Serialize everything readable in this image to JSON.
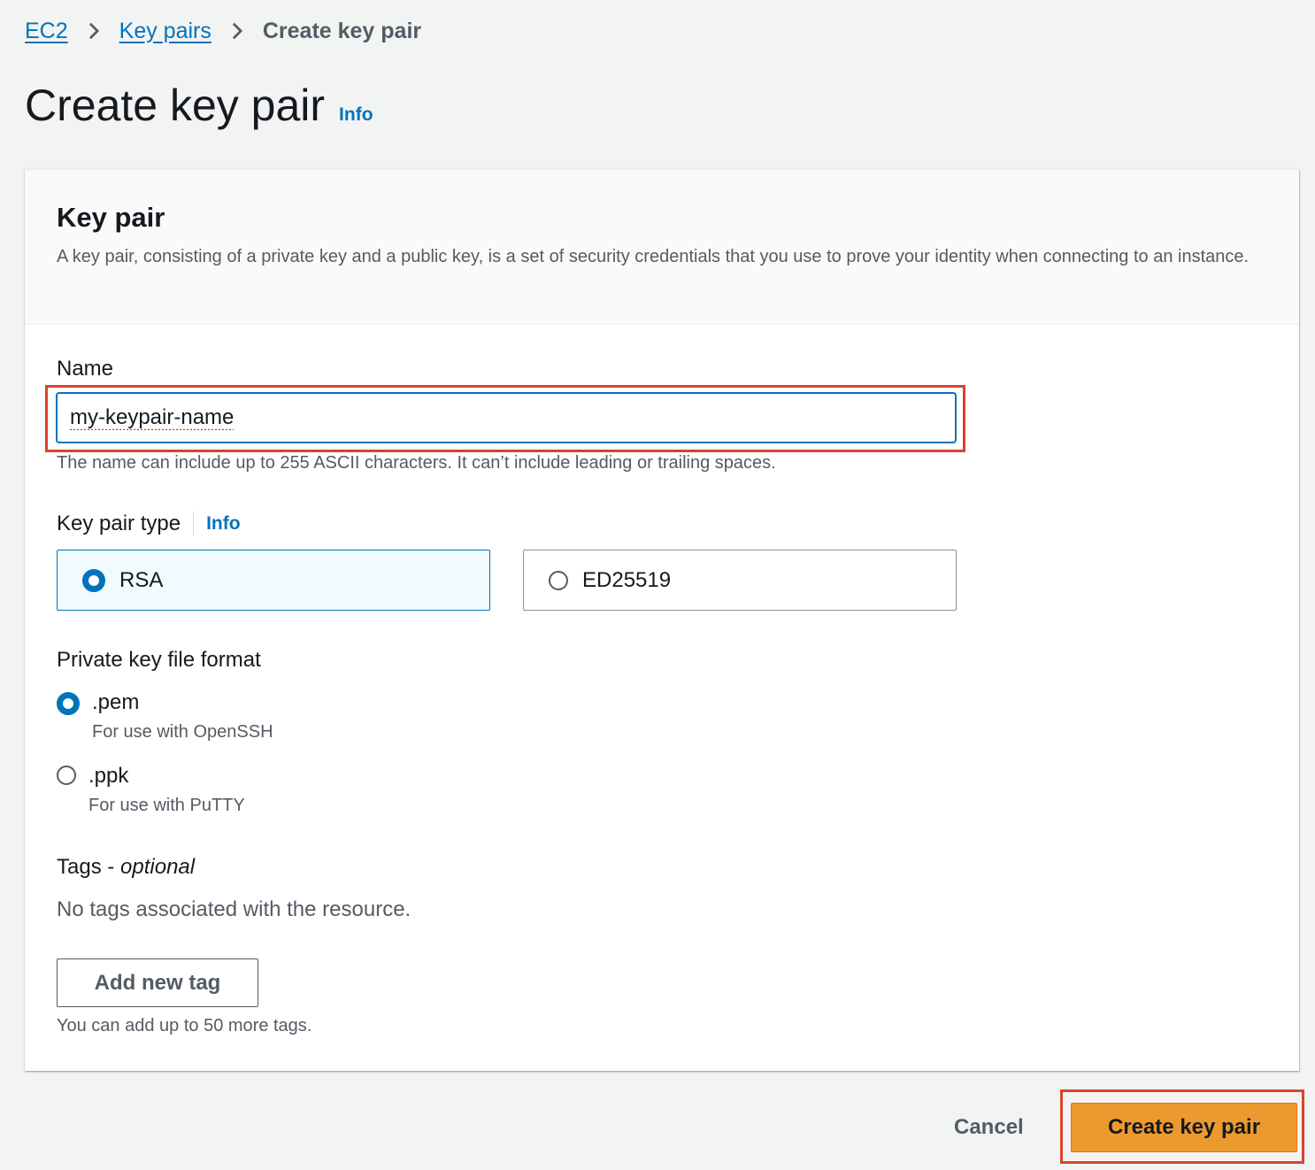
{
  "breadcrumb": {
    "items": [
      {
        "label": "EC2"
      },
      {
        "label": "Key pairs"
      }
    ],
    "current": "Create key pair"
  },
  "page": {
    "title": "Create key pair",
    "info_label": "Info"
  },
  "panel": {
    "title": "Key pair",
    "description": "A key pair, consisting of a private key and a public key, is a set of security credentials that you use to prove your identity when connecting to an instance."
  },
  "name_field": {
    "label": "Name",
    "value": "my-keypair-name",
    "hint": "The name can include up to 255 ASCII characters. It can’t include leading or trailing spaces."
  },
  "key_type": {
    "label": "Key pair type",
    "info_label": "Info",
    "options": [
      {
        "label": "RSA",
        "selected": true
      },
      {
        "label": "ED25519",
        "selected": false
      }
    ]
  },
  "file_format": {
    "label": "Private key file format",
    "options": [
      {
        "label": ".pem",
        "description": "For use with OpenSSH",
        "selected": true
      },
      {
        "label": ".ppk",
        "description": "For use with PuTTY",
        "selected": false
      }
    ]
  },
  "tags": {
    "label": "Tags - ",
    "label_optional": "optional",
    "empty_text": "No tags associated with the resource.",
    "add_button": "Add new tag",
    "limit_hint": "You can add up to 50 more tags."
  },
  "footer": {
    "cancel_label": "Cancel",
    "create_label": "Create key pair"
  },
  "colors": {
    "accent": "#0073bb",
    "primary_button": "#ec9a2f",
    "highlight_border": "#d9432b",
    "background": "#f2f3f3"
  }
}
